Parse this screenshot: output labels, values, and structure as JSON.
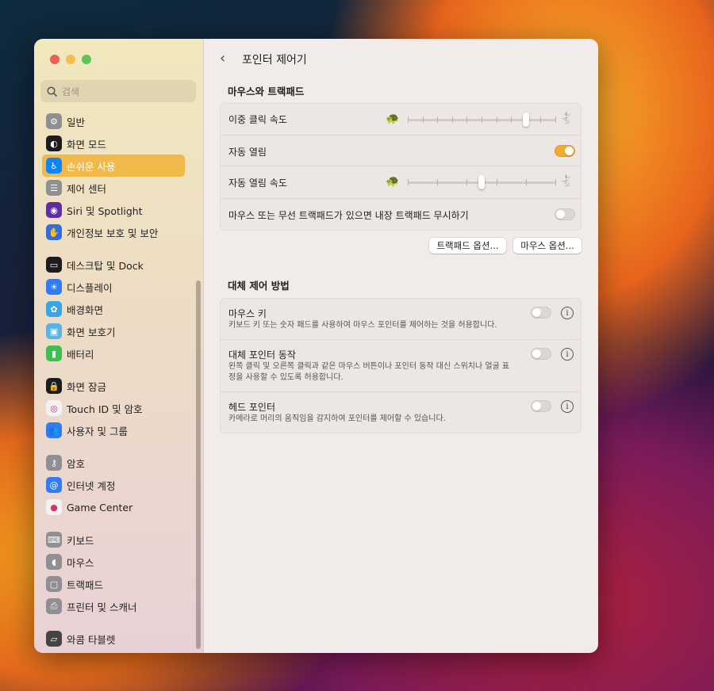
{
  "search": {
    "placeholder": "검색"
  },
  "sidebar": {
    "items": [
      {
        "label": "일반",
        "icon": "gear-icon",
        "color": "#8e8e93"
      },
      {
        "label": "화면 모드",
        "icon": "appearance-icon",
        "color": "#1c1c1e"
      },
      {
        "label": "손쉬운 사용",
        "icon": "accessibility-icon",
        "color": "#0a84ff",
        "selected": true
      },
      {
        "label": "제어 센터",
        "icon": "control-center-icon",
        "color": "#8e8e93"
      },
      {
        "label": "Siri 및 Spotlight",
        "icon": "siri-icon",
        "color": "#5e2ca5"
      },
      {
        "label": "개인정보 보호 및 보안",
        "icon": "hand-icon",
        "color": "#2f6de0"
      },
      {
        "label": "데스크탑 및 Dock",
        "icon": "dock-icon",
        "color": "#1c1c1e"
      },
      {
        "label": "디스플레이",
        "icon": "sun-icon",
        "color": "#2f7cf6"
      },
      {
        "label": "배경화면",
        "icon": "flower-icon",
        "color": "#36a6e8"
      },
      {
        "label": "화면 보호기",
        "icon": "screensaver-icon",
        "color": "#5ab3e6"
      },
      {
        "label": "배터리",
        "icon": "battery-icon",
        "color": "#3fbf4f"
      },
      {
        "label": "화면 잠금",
        "icon": "lock-icon",
        "color": "#1c1c1e"
      },
      {
        "label": "Touch ID 및 암호",
        "icon": "fingerprint-icon",
        "color": "#f2f2f2"
      },
      {
        "label": "사용자 및 그룹",
        "icon": "users-icon",
        "color": "#2f7cf6"
      },
      {
        "label": "암호",
        "icon": "key-icon",
        "color": "#8e8e93"
      },
      {
        "label": "인터넷 계정",
        "icon": "at-icon",
        "color": "#2f7cf6"
      },
      {
        "label": "Game Center",
        "icon": "game-center-icon",
        "color": "#f2f2f2"
      },
      {
        "label": "키보드",
        "icon": "keyboard-icon",
        "color": "#8e8e93"
      },
      {
        "label": "마우스",
        "icon": "mouse-icon",
        "color": "#8e8e93"
      },
      {
        "label": "트랙패드",
        "icon": "trackpad-icon",
        "color": "#8e8e93"
      },
      {
        "label": "프린터 및 스캐너",
        "icon": "printer-icon",
        "color": "#8e8e93"
      },
      {
        "label": "와콤 타블렛",
        "icon": "tablet-icon",
        "color": "#444"
      }
    ]
  },
  "main": {
    "title": "포인터 제어기",
    "section1": "마우스와 트랙패드",
    "double_click_speed": "이중 클릭 속도",
    "spring_loading": "자동 열림",
    "spring_loading_speed": "자동 열림 속도",
    "ignore_trackpad": "마우스 또는 무선 트랙패드가 있으면 내장 트랙패드 무시하기",
    "trackpad_options": "트랙패드 옵션...",
    "mouse_options": "마우스 옵션...",
    "section2": "대체 제어 방법",
    "mouse_keys": "마우스 키",
    "mouse_keys_desc": "키보드 키 또는 숫자 패드를 사용하여 마우스 포인터를 제어하는 것을 허용합니다.",
    "alt_pointer": "대체 포인터 동작",
    "alt_pointer_desc": "왼쪽 클릭 및 오른쪽 클릭과 같은 마우스 버튼이나 포인터 동작 대신 스위치나 얼굴 표정을 사용할 수 있도록 허용합니다.",
    "head_pointer": "헤드 포인터",
    "head_pointer_desc": "카메라로 머리의 움직임을 감지하여 포인터를 제어할 수 있습니다.",
    "help": "?",
    "info": "i"
  },
  "state": {
    "double_click_speed": 0.8,
    "spring_loading_speed": 0.5,
    "spring_loading": true,
    "ignore_trackpad": false,
    "mouse_keys": false,
    "alt_pointer": false,
    "head_pointer": false
  },
  "colors": {
    "accent": "#f0ac2b",
    "selection": "#f0b94a"
  }
}
